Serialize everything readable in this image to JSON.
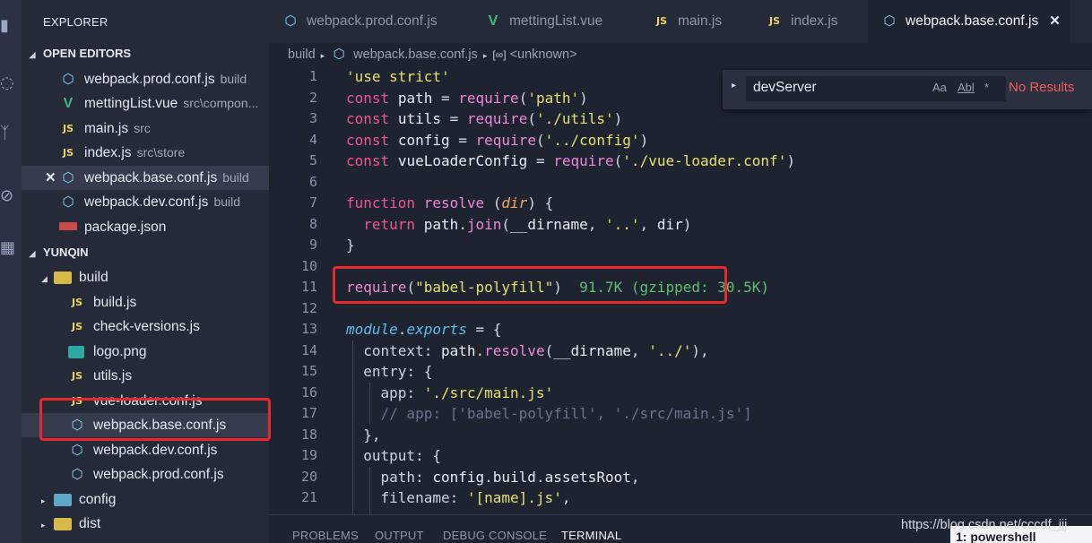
{
  "sidebar": {
    "title": "EXPLORER",
    "open_editors_title": "OPEN EDITORS",
    "open_editors": [
      {
        "name": "webpack.prod.conf.js",
        "desc": "build",
        "icon": "webpack-icon"
      },
      {
        "name": "mettingList.vue",
        "desc": "src\\compon...",
        "icon": "vue-icon"
      },
      {
        "name": "main.js",
        "desc": "src",
        "icon": "js-icon"
      },
      {
        "name": "index.js",
        "desc": "src\\store",
        "icon": "js-icon"
      },
      {
        "name": "webpack.base.conf.js",
        "desc": "build",
        "icon": "webpack-icon",
        "active": true
      },
      {
        "name": "webpack.dev.conf.js",
        "desc": "build",
        "icon": "webpack-icon"
      },
      {
        "name": "package.json",
        "desc": "",
        "icon": "npm-icon"
      }
    ],
    "project_title": "YUNQIN",
    "tree": {
      "build_folder": "build",
      "build_files": [
        {
          "name": "build.js",
          "icon": "js-icon"
        },
        {
          "name": "check-versions.js",
          "icon": "js-icon"
        },
        {
          "name": "logo.png",
          "icon": "image-icon"
        },
        {
          "name": "utils.js",
          "icon": "js-icon"
        },
        {
          "name": "vue-loader.conf.js",
          "icon": "js-icon"
        },
        {
          "name": "webpack.base.conf.js",
          "icon": "webpack-icon",
          "selected": true
        },
        {
          "name": "webpack.dev.conf.js",
          "icon": "webpack-icon"
        },
        {
          "name": "webpack.prod.conf.js",
          "icon": "webpack-icon"
        }
      ],
      "config_folder": "config",
      "dist_folder": "dist"
    }
  },
  "tabs": [
    {
      "label": "webpack.prod.conf.js",
      "icon": "webpack-icon"
    },
    {
      "label": "mettingList.vue",
      "icon": "vue-icon"
    },
    {
      "label": "main.js",
      "icon": "js-icon"
    },
    {
      "label": "index.js",
      "icon": "js-icon"
    },
    {
      "label": "webpack.base.conf.js",
      "icon": "webpack-icon",
      "active": true
    }
  ],
  "breadcrumb": {
    "folder": "build",
    "file": "webpack.base.conf.js",
    "symbol": "<unknown>"
  },
  "find": {
    "value": "devServer",
    "match_case": "Aa",
    "whole_word": "Abl",
    "regex": "*",
    "result": "No Results"
  },
  "editor": {
    "line_numbers": [
      "1",
      "2",
      "3",
      "4",
      "5",
      "6",
      "7",
      "8",
      "9",
      "10",
      "11",
      "12",
      "13",
      "14",
      "15",
      "16",
      "17",
      "18",
      "19",
      "20",
      "21"
    ],
    "import_cost": "91.7K (gzipped: 30.5K)"
  },
  "panel": {
    "tabs": [
      "PROBLEMS",
      "OUTPUT",
      "DEBUG CONSOLE",
      "TERMINAL"
    ],
    "active_tab": "TERMINAL",
    "terminal_select": "1: powershell"
  },
  "watermark": "https://blog.csdn.net/cccdf_jjj",
  "colors": {
    "background": "#1e2330",
    "sidebar": "#252a38",
    "highlight_box": "#e8282e",
    "keyword": "#f0548f",
    "string": "#e6e06e",
    "import_cost": "#5fbf74"
  }
}
